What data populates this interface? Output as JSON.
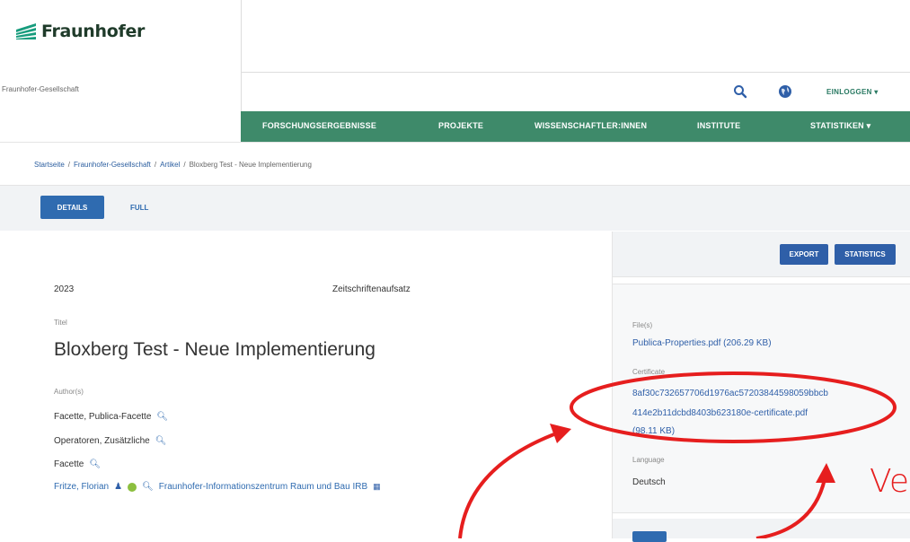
{
  "header": {
    "logo_text": "Fraunhofer",
    "org_name": "Fraunhofer-Gesellschaft",
    "login_label": "EINLOGGEN ▾",
    "search_icon": "search-icon",
    "globe_icon": "globe-icon"
  },
  "nav": {
    "items": [
      "FORSCHUNGSERGEBNISSE",
      "PROJEKTE",
      "WISSENSCHAFTLER:INNEN",
      "INSTITUTE",
      "STATISTIKEN ▾"
    ]
  },
  "breadcrumb": {
    "items": [
      "Startseite",
      "Fraunhofer-Gesellschaft",
      "Artikel"
    ],
    "separator": "/",
    "current": "Bloxberg Test - Neue Implementierung"
  },
  "tabs": {
    "details": "DETAILS",
    "full": "FULL"
  },
  "record": {
    "year": "2023",
    "type": "Zeitschriftenaufsatz",
    "title_label": "Titel",
    "title": "Bloxberg Test - Neue Implementierung",
    "authors_label": "Author(s)",
    "authors": [
      "Facette, Publica-Facette",
      "Operatoren, Zusätzliche",
      "Facette"
    ],
    "last_author": "Fritze, Florian",
    "last_author_org": "Fraunhofer-Informationszentrum Raum und Bau IRB"
  },
  "sidebar": {
    "export_label": "EXPORT",
    "statistics_label": "STATISTICS",
    "files_label": "File(s)",
    "file_link": "Publica-Properties.pdf (206.29 KB)",
    "certificate_label": "Certificate",
    "certificate_line1": "8af30c732657706d1976ac57203844598059bbcb",
    "certificate_line2": "414e2b11dcbd8403b623180e-certificate.pdf",
    "certificate_line3": "(98.11 KB)",
    "language_label": "Language",
    "language_value": "Deutsch"
  },
  "annotation": {
    "text": "Ve",
    "color": "#e61e1e"
  },
  "colors": {
    "nav_green": "#3e8a6a",
    "button_blue": "#2f5fa8",
    "link_blue": "#2f6bb0"
  }
}
